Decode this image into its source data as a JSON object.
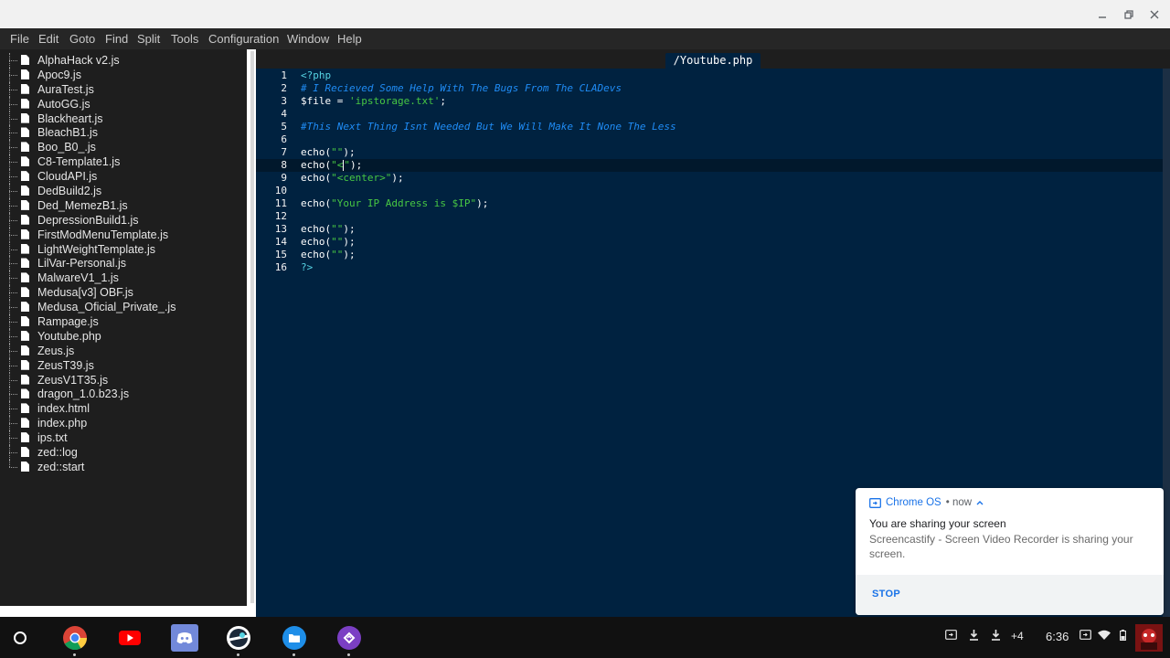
{
  "window": {
    "minimize_label": "minimize",
    "maximize_label": "restore",
    "close_label": "close"
  },
  "menu": [
    "File",
    "Edit",
    "Goto",
    "Find",
    "Split",
    "Tools",
    "Configuration",
    "Window",
    "Help"
  ],
  "files": [
    "AlphaHack v2.js",
    "Apoc9.js",
    "AuraTest.js",
    "AutoGG.js",
    "Blackheart.js",
    "BleachB1.js",
    "Boo_B0_.js",
    "C8-Template1.js",
    "CloudAPI.js",
    "DedBuild2.js",
    "Ded_MemezB1.js",
    "DepressionBuild1.js",
    "FirstModMenuTemplate.js",
    "LightWeightTemplate.js",
    "LilVar-Personal.js",
    "MalwareV1_1.js",
    "Medusa[v3] OBF.js",
    "Medusa_Oficial_Private_.js",
    "Rampage.js",
    "Youtube.php",
    "Zeus.js",
    "ZeusT39.js",
    "ZeusV1T35.js",
    "dragon_1.0.b23.js",
    "index.html",
    "index.php",
    "ips.txt",
    "zed::log",
    "zed::start"
  ],
  "editor": {
    "tab_title": "/Youtube.php",
    "active_line": 8,
    "lines": [
      {
        "n": "1",
        "parts": [
          {
            "t": "<?php",
            "c": "c-tag"
          }
        ]
      },
      {
        "n": "2",
        "parts": [
          {
            "t": "# I Recieved Some Help With The Bugs From The CLADevs",
            "c": "c-comment"
          }
        ]
      },
      {
        "n": "3",
        "parts": [
          {
            "t": "$file = ",
            "c": "c-var"
          },
          {
            "t": "'ipstorage.txt'",
            "c": "c-str"
          },
          {
            "t": ";",
            "c": "c-var"
          }
        ]
      },
      {
        "n": "4",
        "parts": []
      },
      {
        "n": "5",
        "parts": [
          {
            "t": "#This Next Thing Isnt Needed But We Will Make It None The Less",
            "c": "c-comment"
          }
        ]
      },
      {
        "n": "6",
        "parts": []
      },
      {
        "n": "7",
        "parts": [
          {
            "t": "echo(",
            "c": "c-var"
          },
          {
            "t": "\"\"",
            "c": "c-str"
          },
          {
            "t": ");",
            "c": "c-var"
          }
        ]
      },
      {
        "n": "8",
        "parts": [
          {
            "t": "echo(",
            "c": "c-var"
          },
          {
            "t": "\"<",
            "c": "c-str"
          },
          {
            "t": "CURSOR",
            "c": "cursor"
          },
          {
            "t": "\"",
            "c": "c-str"
          },
          {
            "t": ");",
            "c": "c-var"
          }
        ]
      },
      {
        "n": "9",
        "parts": [
          {
            "t": "echo(",
            "c": "c-var"
          },
          {
            "t": "\"<center>\"",
            "c": "c-str"
          },
          {
            "t": ");",
            "c": "c-var"
          }
        ]
      },
      {
        "n": "10",
        "parts": []
      },
      {
        "n": "11",
        "parts": [
          {
            "t": "echo(",
            "c": "c-var"
          },
          {
            "t": "\"Your IP Address is $IP\"",
            "c": "c-str"
          },
          {
            "t": ");",
            "c": "c-var"
          }
        ]
      },
      {
        "n": "12",
        "parts": []
      },
      {
        "n": "13",
        "parts": [
          {
            "t": "echo(",
            "c": "c-var"
          },
          {
            "t": "\"\"",
            "c": "c-str"
          },
          {
            "t": ");",
            "c": "c-var"
          }
        ]
      },
      {
        "n": "14",
        "parts": [
          {
            "t": "echo(",
            "c": "c-var"
          },
          {
            "t": "\"\"",
            "c": "c-str"
          },
          {
            "t": ");",
            "c": "c-var"
          }
        ]
      },
      {
        "n": "15",
        "parts": [
          {
            "t": "echo(",
            "c": "c-var"
          },
          {
            "t": "\"\"",
            "c": "c-str"
          },
          {
            "t": ");",
            "c": "c-var"
          }
        ]
      },
      {
        "n": "16",
        "parts": [
          {
            "t": "?>",
            "c": "c-tag"
          }
        ]
      }
    ]
  },
  "notification": {
    "source": "Chrome OS",
    "time": "• now",
    "title": "You are sharing your screen",
    "body": "Screencastify - Screen Video Recorder is sharing your screen.",
    "action": "STOP"
  },
  "shelf": {
    "apps": [
      "launcher",
      "chrome",
      "youtube",
      "discord",
      "steam",
      "files",
      "app"
    ],
    "more_badge": "+4",
    "clock": "6:36"
  },
  "colors": {
    "editor_bg": "#002240",
    "sidebar_bg": "#1e1e1e",
    "comment": "#1f8cf5",
    "string": "#47c743",
    "tag": "#56d3e3",
    "accent": "#1a73e8"
  }
}
